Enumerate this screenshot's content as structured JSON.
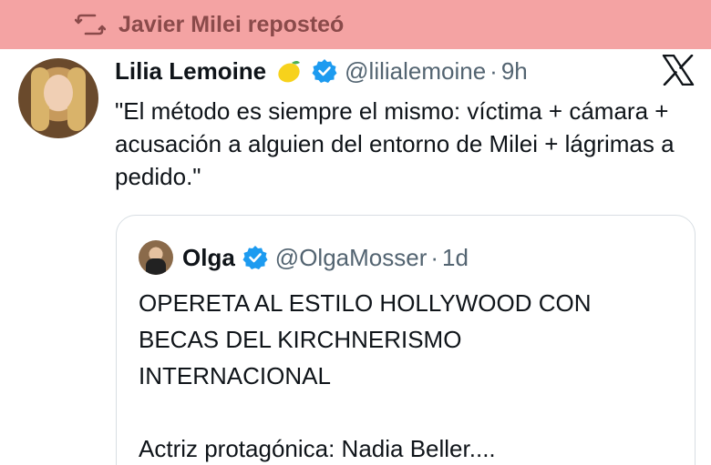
{
  "repost": {
    "text": "Javier Milei reposteó",
    "icon": "repost-icon"
  },
  "tweet": {
    "display_name": "Lilia Lemoine",
    "emoji": "lemon-emoji",
    "verified_icon": "verified-badge-icon",
    "handle": "@lilialemoine",
    "separator": "·",
    "time": "9h",
    "platform_icon": "x-logo-icon",
    "text": "\"El método es siempre el mismo: víctima + cámara + acusación a alguien del entorno de Milei + lágrimas a pedido.\""
  },
  "quote": {
    "display_name": "Olga",
    "verified_icon": "verified-badge-icon",
    "handle": "@OlgaMosser",
    "separator": "·",
    "time": "1d",
    "lines": [
      "OPERETA AL ESTILO HOLLYWOOD CON",
      "BECAS DEL KIRCHNERISMO",
      "INTERNACIONAL"
    ],
    "last_line": "Actriz protagónica: Nadia Beller...."
  },
  "colors": {
    "repost_bar": "#f4a3a3",
    "repost_text": "#8a4a4a",
    "verified_blue": "#1d9bf0",
    "muted_text": "#536471",
    "main_text": "#0f1419"
  }
}
